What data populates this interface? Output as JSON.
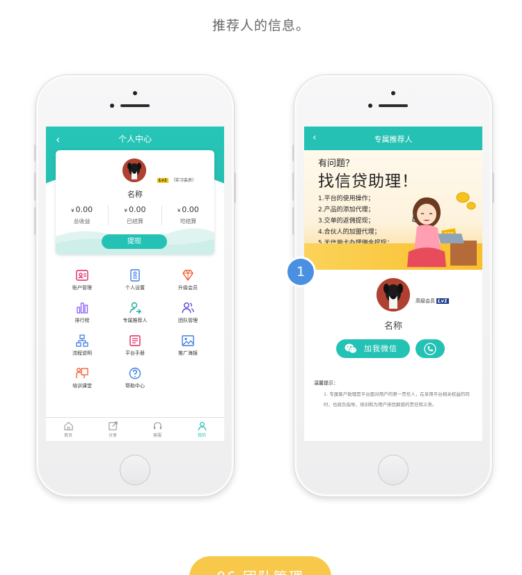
{
  "caption": "推荐人的信息。",
  "left_phone": {
    "header_title": "个人中心",
    "user": {
      "name": "名称",
      "level_tag": "Lv1",
      "level_label": "（实习会员）"
    },
    "stats": [
      {
        "currency": "¥",
        "value": "0.00",
        "label": "总收益"
      },
      {
        "currency": "¥",
        "value": "0.00",
        "label": "已结算"
      },
      {
        "currency": "¥",
        "value": "0.00",
        "label": "可结算"
      }
    ],
    "withdraw_label": "提现",
    "grid": [
      {
        "label": "账户管理",
        "icon": "account-icon"
      },
      {
        "label": "个人设置",
        "icon": "settings-doc-icon"
      },
      {
        "label": "升级会员",
        "icon": "diamond-icon"
      },
      {
        "label": "排行榜",
        "icon": "bar-chart-icon"
      },
      {
        "label": "专属推荐人",
        "icon": "referrer-icon"
      },
      {
        "label": "团队管理",
        "icon": "team-icon"
      },
      {
        "label": "流程说明",
        "icon": "flowchart-icon"
      },
      {
        "label": "平台手册",
        "icon": "manual-icon"
      },
      {
        "label": "推广海报",
        "icon": "poster-icon"
      },
      {
        "label": "培训课堂",
        "icon": "training-icon"
      },
      {
        "label": "帮助中心",
        "icon": "help-icon"
      }
    ],
    "tabs": [
      {
        "label": "首页",
        "icon": "home-icon"
      },
      {
        "label": "分享",
        "icon": "share-icon"
      },
      {
        "label": "客服",
        "icon": "headset-icon"
      },
      {
        "label": "我的",
        "icon": "user-icon"
      }
    ],
    "active_tab": "我的"
  },
  "right_phone": {
    "header_title": "专属推荐人",
    "banner": {
      "question": "有问题？",
      "headline": "找信贷助理！",
      "items": [
        "1.平台的使用操作；",
        "2.产品的添加代理；",
        "3.交单的返佣提现；",
        "4.合伙人的加盟代理；",
        "5.无信用卡办理佣金提现；"
      ],
      "coin_value": "100"
    },
    "referrer": {
      "level_label": "高级会员",
      "level_tag": "Lv1",
      "name": "名称"
    },
    "wechat_button": "加我微信",
    "tips_title": "温馨提示：",
    "tips_text": "1. 专属客户助理是平台面对用户的第一责任人，在享用平台相关权益的同时，也肩负指导，培训和为用户排忧解惑的责任和义务。"
  },
  "callout_number": "1",
  "next_section": "06 团队管理",
  "colors": {
    "teal": "#24c2b4",
    "callout_blue": "#4a90e2",
    "section_yellow": "#f8c84a"
  }
}
